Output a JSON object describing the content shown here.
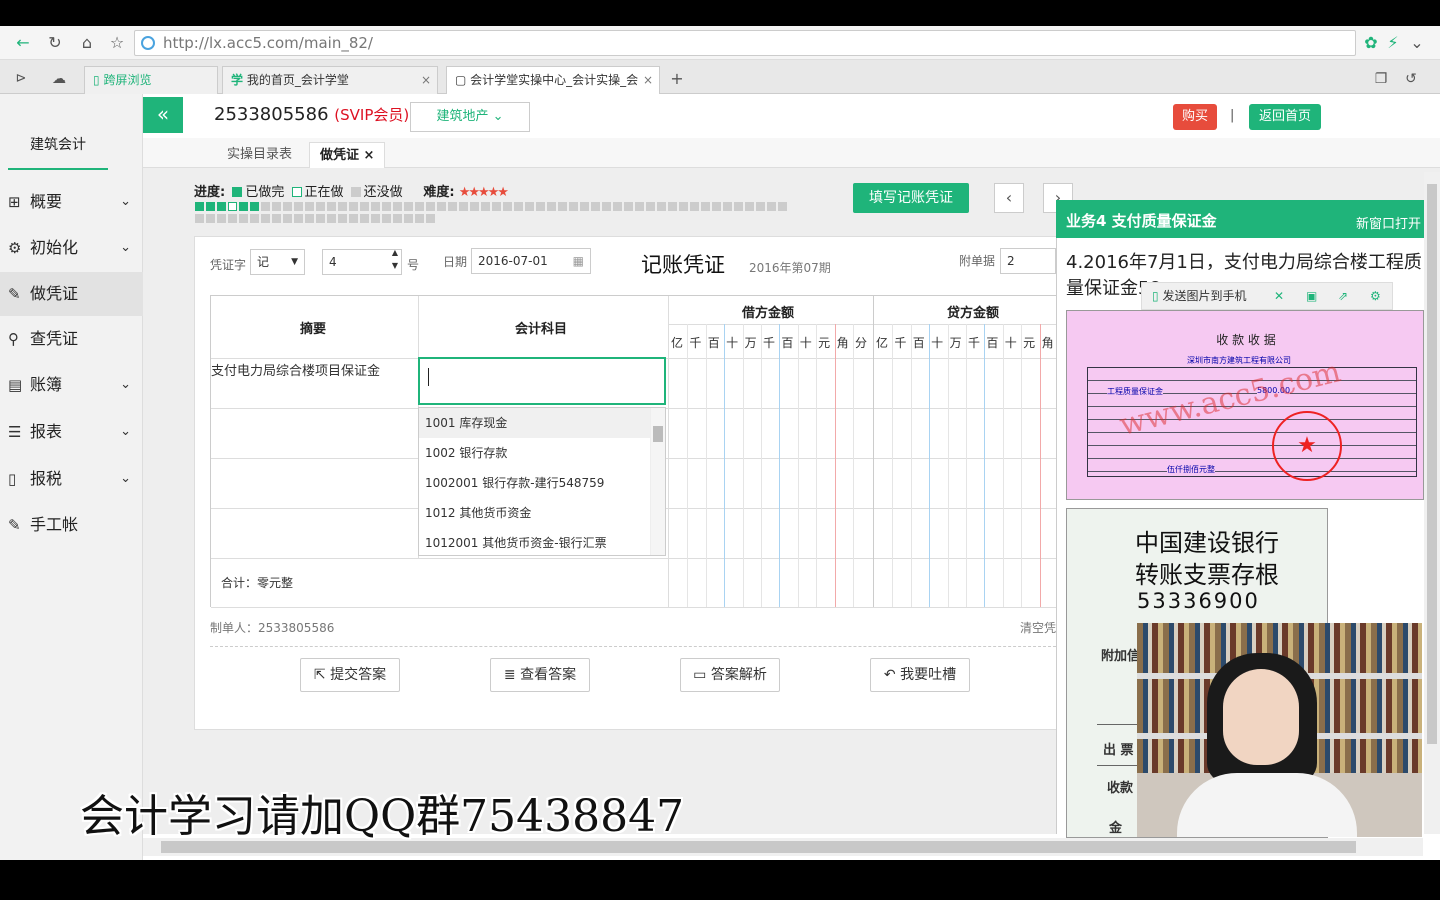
{
  "browser": {
    "url": "http://lx.acc5.com/main_82/",
    "tabs": [
      {
        "label": "跨屏浏览"
      },
      {
        "label": "我的首页_会计学堂"
      },
      {
        "label": "会计学堂实操中心_会计实操_会"
      }
    ]
  },
  "sidebar": {
    "brand": "建筑会计",
    "items": [
      {
        "label": "概要",
        "icon": "grid-icon"
      },
      {
        "label": "初始化",
        "icon": "gear-icon"
      },
      {
        "label": "做凭证",
        "icon": "pen-icon"
      },
      {
        "label": "查凭证",
        "icon": "search-icon"
      },
      {
        "label": "账簿",
        "icon": "book-icon"
      },
      {
        "label": "报表",
        "icon": "list-icon"
      },
      {
        "label": "报税",
        "icon": "file-icon"
      },
      {
        "label": "手工帐",
        "icon": "pen-icon"
      }
    ]
  },
  "header": {
    "user_id": "2533805586",
    "member": "(SVIP会员)",
    "industry": "建筑地产",
    "buy": "购买",
    "separator": "|",
    "home": "返回首页"
  },
  "page_tabs": [
    {
      "label": "实操目录表"
    },
    {
      "label": "做凭证"
    }
  ],
  "progress": {
    "label": "进度:",
    "done": "已做完",
    "doing": "正在做",
    "todo": "还没做",
    "difficulty": "难度:",
    "stars": "★★★★★",
    "fill_button": "填写记账凭证"
  },
  "voucher": {
    "word_label": "凭证字",
    "word_value": "记",
    "number_value": "4",
    "number_unit": "号",
    "date_label": "日期",
    "date_value": "2016-07-01",
    "title": "记账凭证",
    "period": "2016年第07期",
    "attach_label": "附单据",
    "attach_value": "2",
    "col_summary": "摘要",
    "col_account": "会计科目",
    "col_debit": "借方金额",
    "col_credit": "贷方金额",
    "digits": [
      "亿",
      "千",
      "百",
      "十",
      "万",
      "千",
      "百",
      "十",
      "元",
      "角",
      "分"
    ],
    "row1_summary": "支付电力局综合楼项目保证金",
    "total": "合计：零元整",
    "maker": "制单人：2533805586",
    "clear": "清空凭",
    "dropdown": [
      "1001 库存现金",
      "1002 银行存款",
      "1002001 银行存款-建行548759",
      "1012 其他货币资金",
      "1012001 其他货币资金-银行汇票"
    ]
  },
  "actions": {
    "submit": "提交答案",
    "view": "查看答案",
    "analysis": "答案解析",
    "complain": "我要吐槽"
  },
  "panel": {
    "title": "业务4 支付质量保证金",
    "new_window": "新窗口打开",
    "description": "4.2016年7月1日，支付电力局综合楼工程质量保证金58",
    "send_phone": "发送图片到手机",
    "receipt_title": "收 款 收 据",
    "receipt_unit": "深圳市南方建筑工程有限公司",
    "receipt_item": "工程质量保证金",
    "receipt_amount": "5800.00",
    "receipt_total_cn": "伍仟捌佰元整",
    "receipt_watermark": "www.acc5.com",
    "check_bank": "中国建设银行",
    "check_type": "转账支票存根",
    "check_number": "53336900",
    "check_label1": "附加信",
    "check_label2": "出 票",
    "check_label3": "收款",
    "check_label4": "金"
  },
  "watermark": "会计学习请加QQ群75438847",
  "colors": {
    "accent": "#1fb47a",
    "buy": "#e74c3c",
    "svip": "#dd1122"
  }
}
